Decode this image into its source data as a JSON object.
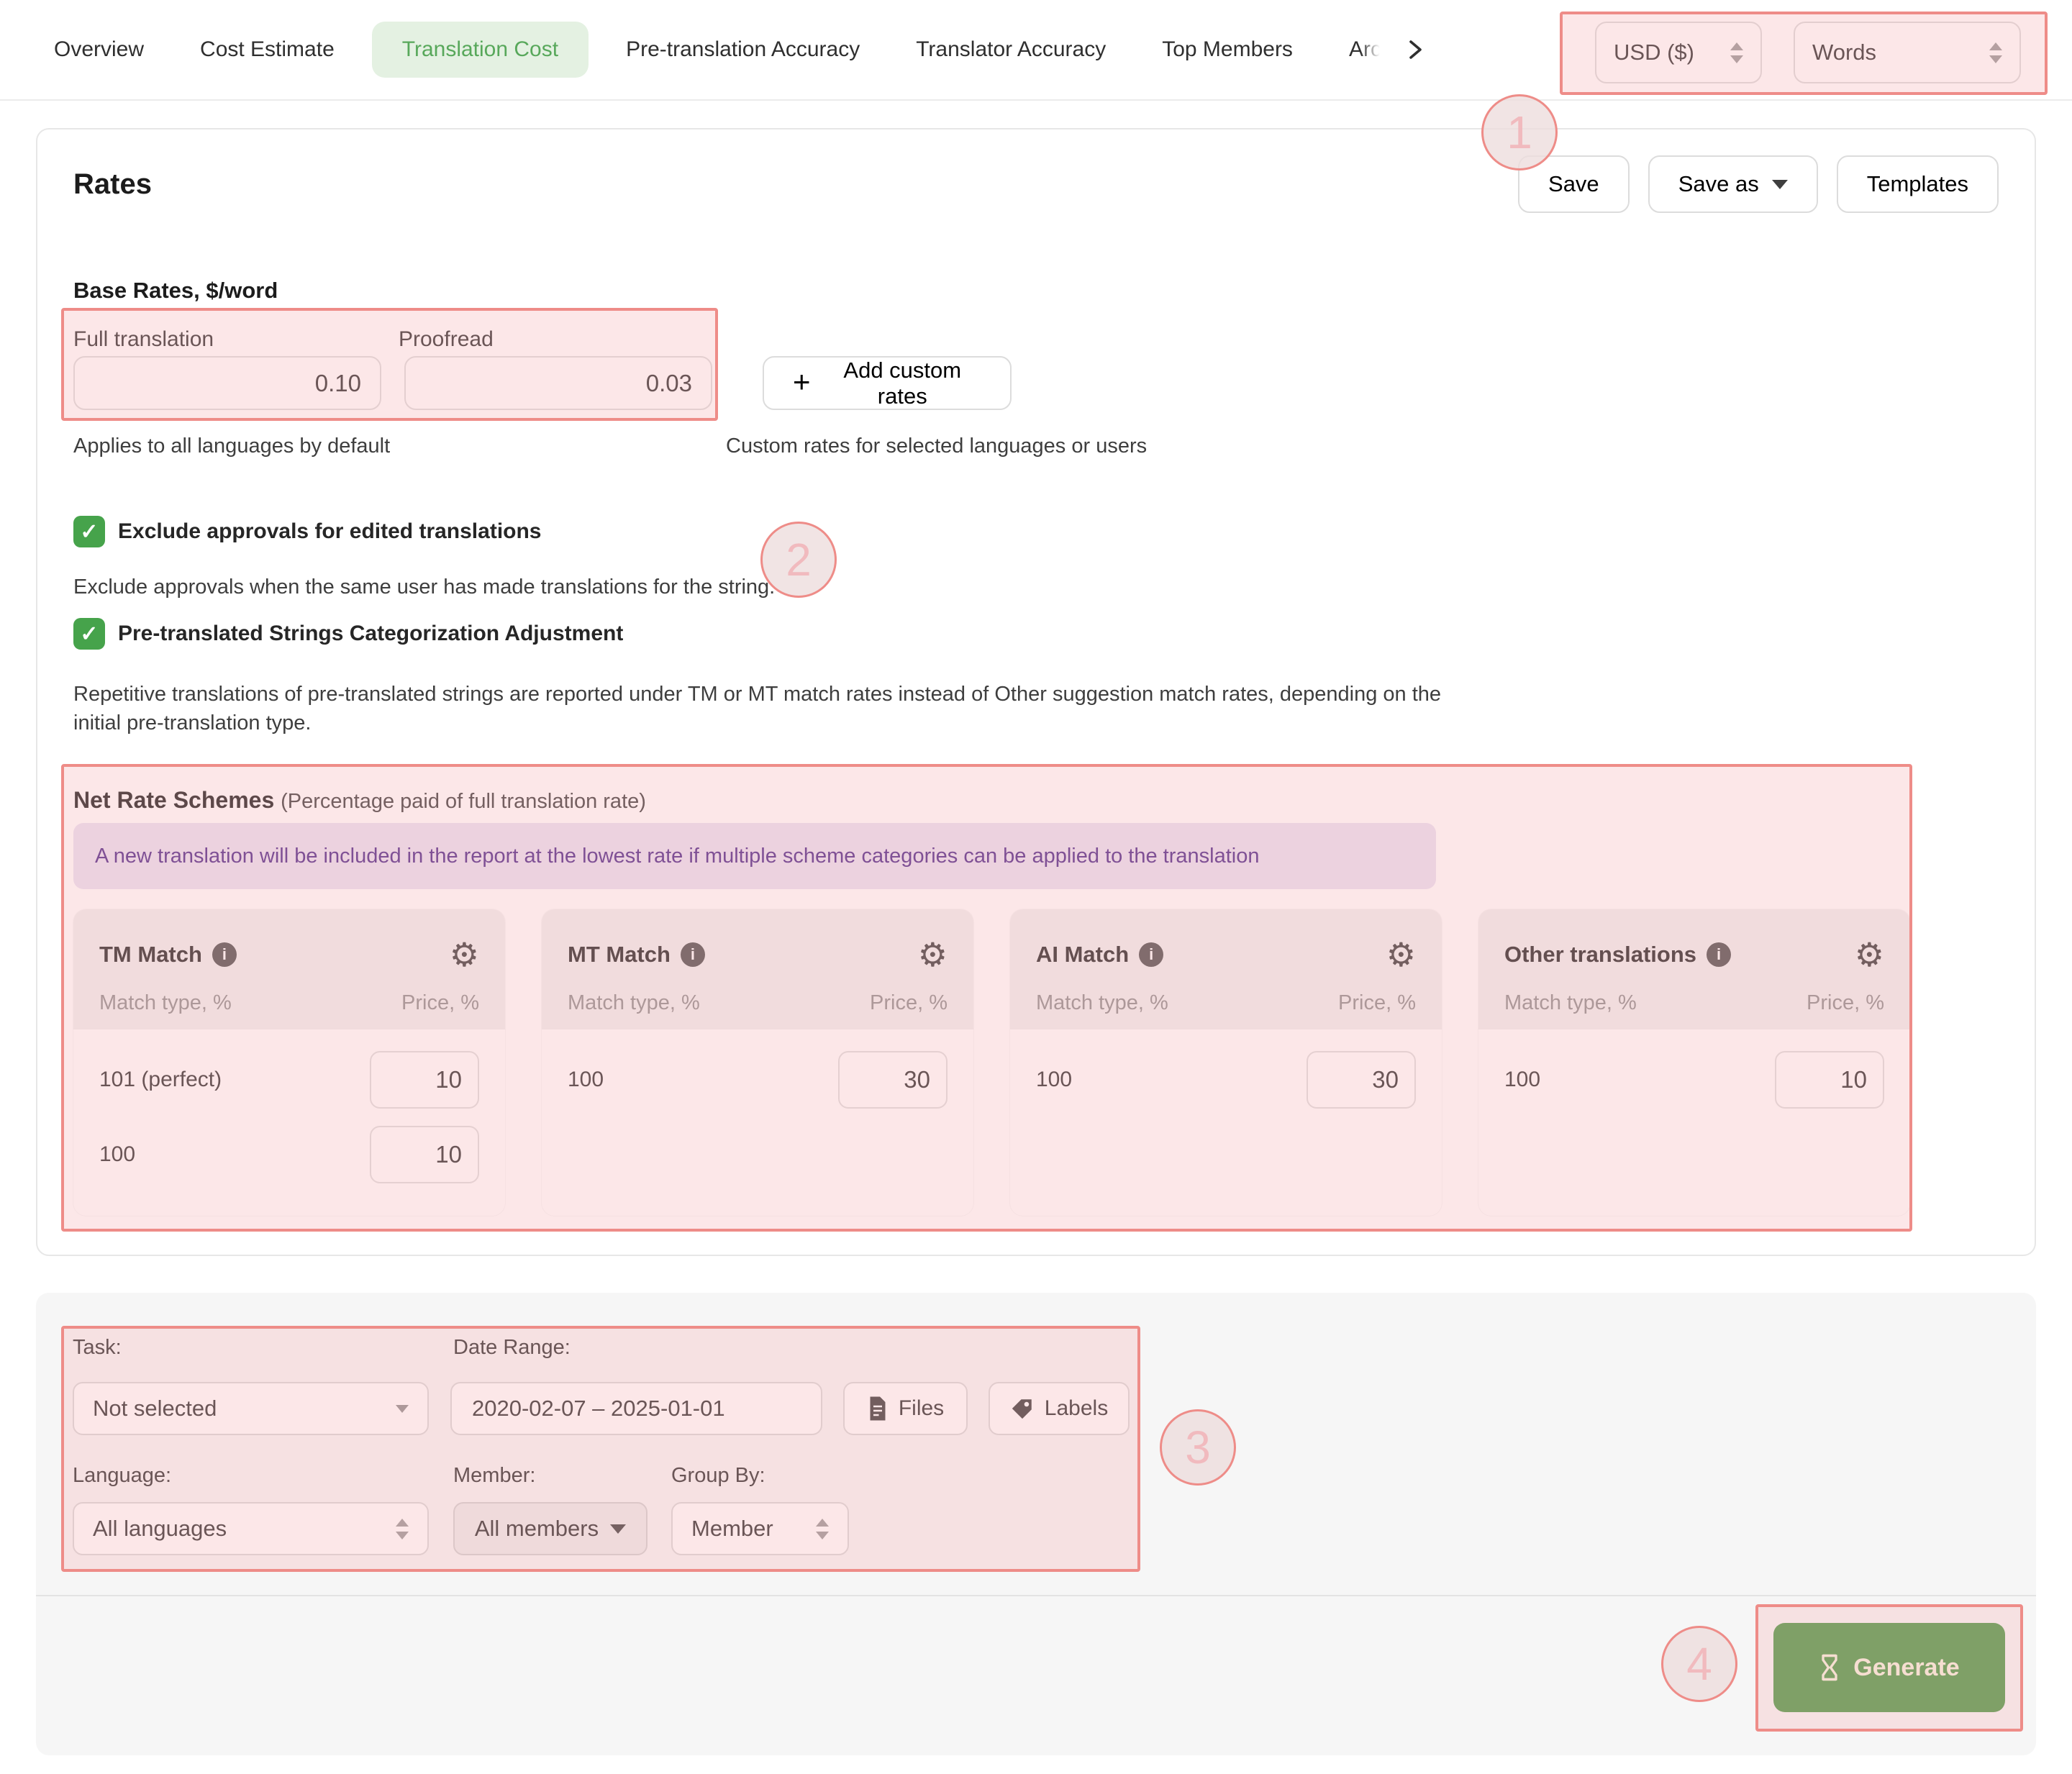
{
  "tabs": {
    "items": [
      {
        "label": "Overview"
      },
      {
        "label": "Cost Estimate"
      },
      {
        "label": "Translation Cost"
      },
      {
        "label": "Pre-translation Accuracy"
      },
      {
        "label": "Translator Accuracy"
      },
      {
        "label": "Top Members"
      },
      {
        "label": "Arc"
      }
    ],
    "active": "Translation Cost"
  },
  "header_controls": {
    "currency": "USD ($)",
    "unit": "Words"
  },
  "rates": {
    "title": "Rates",
    "buttons": {
      "save": "Save",
      "save_as": "Save as",
      "templates": "Templates"
    },
    "base": {
      "heading": "Base Rates, $/word",
      "full_label": "Full translation",
      "full_value": "0.10",
      "proofread_label": "Proofread",
      "proofread_value": "0.03",
      "add_button": "Add custom rates",
      "left_caption": "Applies to all languages by default",
      "right_caption": "Custom rates for selected languages or users"
    },
    "options": [
      {
        "label": "Exclude approvals for edited translations",
        "description": "Exclude approvals when the same user has made translations for the string."
      },
      {
        "label": "Pre-translated Strings Categorization Adjustment",
        "description": "Repetitive translations of pre-translated strings are reported under TM or MT match rates instead of Other suggestion match rates, depending on the initial pre-translation type."
      }
    ],
    "net": {
      "heading": "Net Rate Schemes",
      "subheading": "(Percentage paid of full translation rate)",
      "banner": "A new translation will be included in the report at the lowest rate if multiple scheme categories can be applied to the translation",
      "col_match": "Match type, %",
      "col_price": "Price, %",
      "cards": [
        {
          "title": "TM Match",
          "rows": [
            {
              "match": "101 (perfect)",
              "price": "10"
            },
            {
              "match": "100",
              "price": "10"
            }
          ]
        },
        {
          "title": "MT Match",
          "rows": [
            {
              "match": "100",
              "price": "30"
            }
          ]
        },
        {
          "title": "AI Match",
          "rows": [
            {
              "match": "100",
              "price": "30"
            }
          ]
        },
        {
          "title": "Other translations",
          "rows": [
            {
              "match": "100",
              "price": "10"
            }
          ]
        }
      ]
    }
  },
  "filters": {
    "task_label": "Task:",
    "task_value": "Not selected",
    "date_label": "Date Range:",
    "date_value": "2020-02-07 – 2025-01-01",
    "files_button": "Files",
    "labels_button": "Labels",
    "language_label": "Language:",
    "language_value": "All languages",
    "member_label": "Member:",
    "member_value": "All members",
    "group_label": "Group By:",
    "group_value": "Member"
  },
  "generate_button": "Generate",
  "annotations": {
    "step1": "1",
    "step2": "2",
    "step3": "3",
    "step4": "4"
  },
  "colors": {
    "accent_green": "#4c9a47",
    "active_tab_bg": "#e4f1e2",
    "active_tab_text": "#58a85b",
    "annotation_red": "#ee8c88",
    "banner_text": "#4c2889",
    "checkbox_green": "#46a34b"
  }
}
